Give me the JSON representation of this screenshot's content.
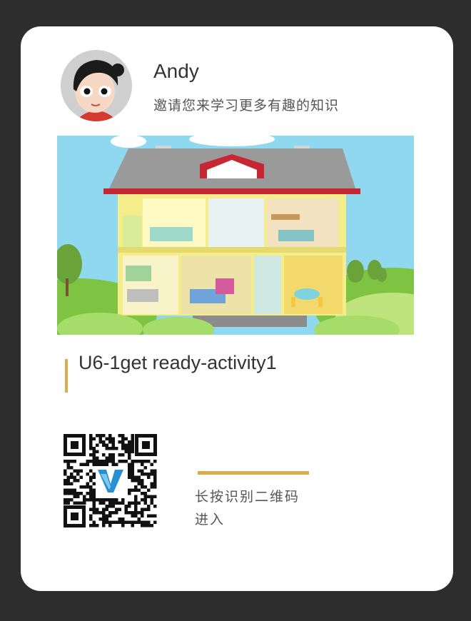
{
  "profile": {
    "name": "Andy",
    "invite_text": "邀请您来学习更多有趣的知识"
  },
  "lesson": {
    "title": "U6-1get ready-activity1"
  },
  "qr": {
    "hint_line1": "长按识别二维码",
    "hint_line2": "进入"
  },
  "colors": {
    "accent": "#d8ad4a",
    "background": "#2d2d2d",
    "card": "#ffffff"
  },
  "icons": {
    "avatar": "cartoon-avatar-icon",
    "qr_logo": "v-logo-icon"
  }
}
